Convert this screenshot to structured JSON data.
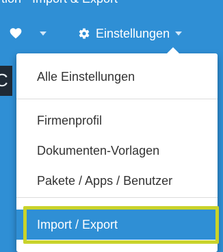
{
  "breadcrumb": {
    "text": "tion - Import & Export"
  },
  "navbar": {
    "favorites_icon": "heart-icon",
    "settings_icon": "gear-icon",
    "settings_label": "Einstellungen"
  },
  "background_peek": {
    "text": "C"
  },
  "dropdown": {
    "items": [
      {
        "label": "Alle Einstellungen"
      },
      {
        "label": "Firmenprofil"
      },
      {
        "label": "Dokumenten-Vorlagen"
      },
      {
        "label": "Pakete / Apps / Benutzer"
      },
      {
        "label": "Import / Export",
        "active": true
      }
    ]
  },
  "colors": {
    "primary": "#2f8fd5",
    "highlight_border": "#c9d32a",
    "menu_text": "#333333"
  }
}
